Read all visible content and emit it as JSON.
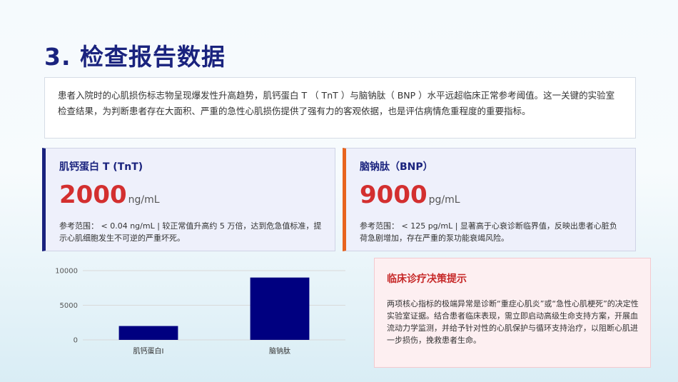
{
  "slide": {
    "title": "3. 检查报告数据",
    "summary": "患者入院时的心肌损伤标志物呈现爆发性升高趋势，肌钙蛋白 T （ TnT ）与脑钠肽（ BNP ）水平远超临床正常参考阈值。这一关键的实验室检查结果，为判断患者存在大面积、严重的急性心肌损伤提供了强有力的客观依据，也是评估病情危重程度的重要指标。"
  },
  "metrics": [
    {
      "name": "肌钙蛋白 T (TnT)",
      "value": "2000",
      "unit": "ng/mL",
      "note": "参考范围： < 0.04 ng/mL | 较正常值升高约 5 万倍，达到危急值标准，提示心肌细胞发生不可逆的严重坏死。",
      "accent": "#1a237e"
    },
    {
      "name": "脑钠肽（BNP）",
      "value": "9000",
      "unit": "pg/mL",
      "note": "参考范围： < 125 pg/mL | 显著高于心衰诊断临界值，反映出患者心脏负荷急剧增加，存在严重的泵功能衰竭风险。",
      "accent": "#e8641e"
    }
  ],
  "chart_data": {
    "type": "bar",
    "categories": [
      "肌钙蛋白I",
      "脑钠肽"
    ],
    "values": [
      2000,
      9000
    ],
    "ylim": [
      0,
      10000
    ],
    "yticks": [
      0,
      5000,
      10000
    ],
    "grid": true,
    "bar_color": "#000080",
    "title": "",
    "xlabel": "",
    "ylabel": ""
  },
  "decision": {
    "title": "临床诊疗决策提示",
    "text": "两项核心指标的极端异常是诊断“重症心肌炎”或“急性心肌梗死”的决定性实验室证据。结合患者临床表现，需立即启动高级生命支持方案，开展血流动力学监测，并给予针对性的心肌保护与循环支持治疗，以阻断心肌进一步损伤，挽救患者生命。"
  },
  "colors": {
    "title": "#1a237e",
    "value": "#d32f2f",
    "decision_title": "#c62828"
  }
}
